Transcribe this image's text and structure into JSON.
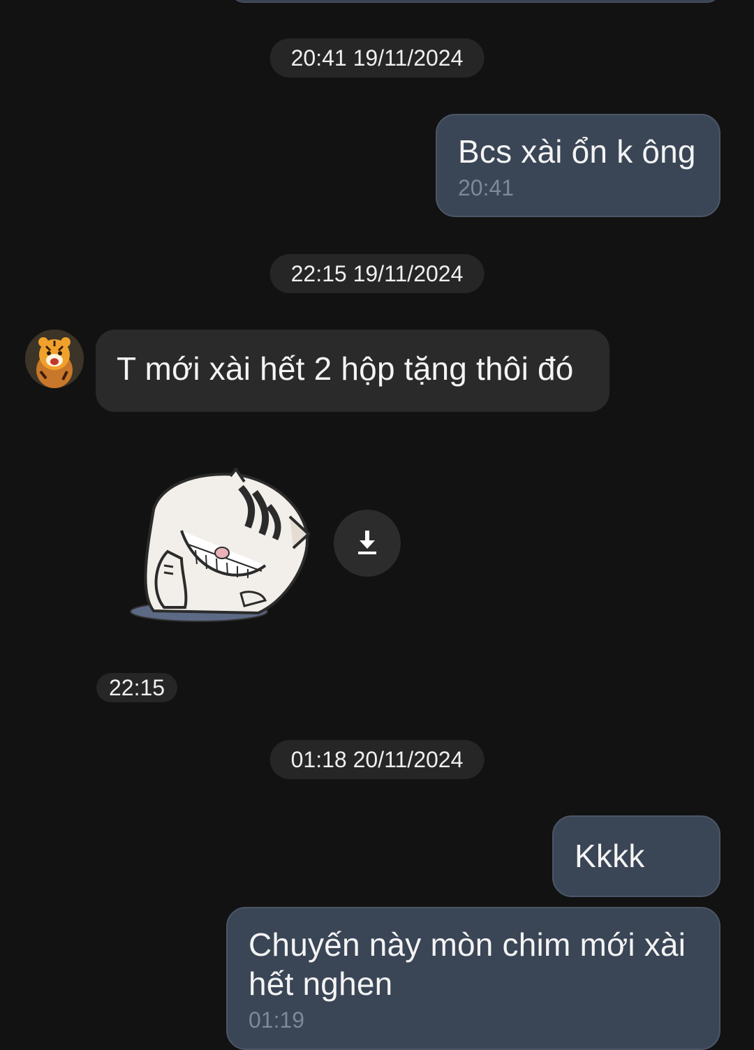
{
  "conversation": {
    "separators": [
      {
        "label": "20:41 19/11/2024"
      },
      {
        "label": "22:15 19/11/2024"
      },
      {
        "label": "01:18 20/11/2024"
      }
    ],
    "messages": [
      {
        "direction": "outgoing",
        "text": "Bcs xài ổn k ông",
        "time": "20:41"
      },
      {
        "direction": "incoming",
        "text": "T mới xài hết 2 hộp tặng thôi đó"
      },
      {
        "direction": "incoming",
        "type": "sticker",
        "sticker_icon": "laughing-cat-sticker",
        "time": "22:15"
      },
      {
        "direction": "outgoing",
        "text": "Kkkk"
      },
      {
        "direction": "outgoing",
        "text": "Chuyến này mòn chim mới xài hết nghen",
        "time": "01:19"
      }
    ]
  },
  "icons": {
    "download": "download-icon",
    "avatar": "tiger-avatar"
  },
  "colors": {
    "background": "#121212",
    "outgoing_bubble": "#3a4556",
    "incoming_bubble": "#2a2a2a",
    "chip": "#262626",
    "timestamp_text": "#7f8896"
  }
}
